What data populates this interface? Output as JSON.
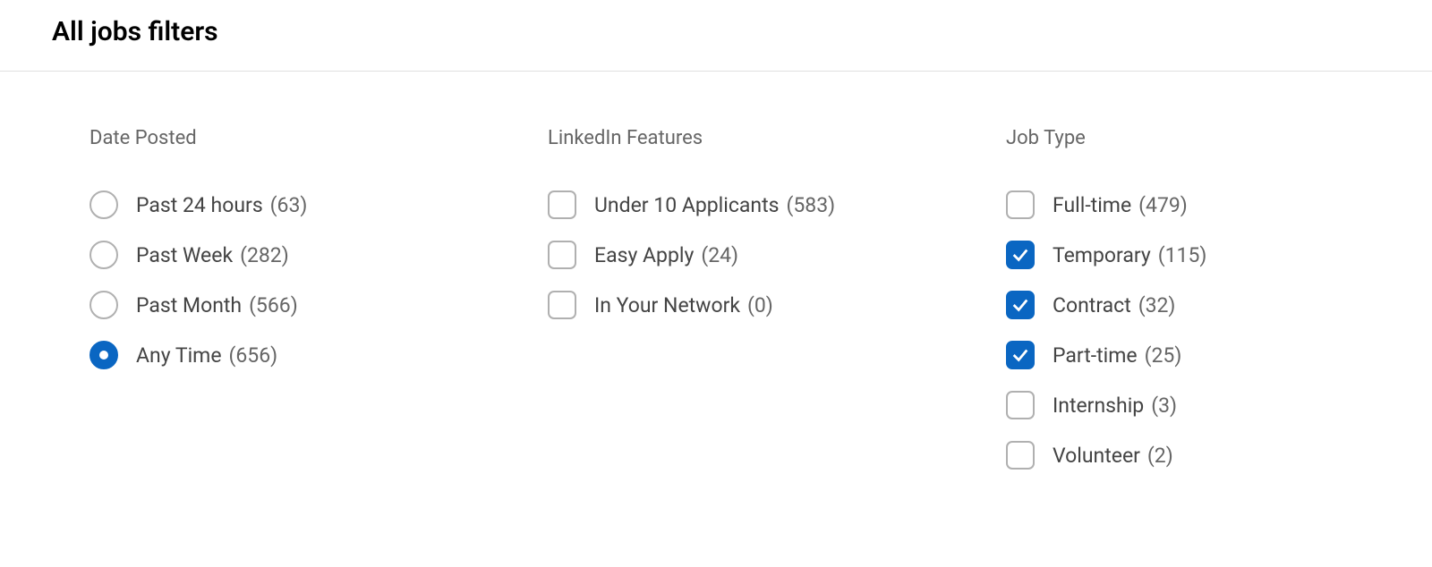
{
  "header": {
    "title": "All jobs filters"
  },
  "groups": {
    "datePosted": {
      "title": "Date Posted",
      "options": [
        {
          "label": "Past 24 hours",
          "count": "(63)",
          "selected": false
        },
        {
          "label": "Past Week",
          "count": "(282)",
          "selected": false
        },
        {
          "label": "Past Month",
          "count": "(566)",
          "selected": false
        },
        {
          "label": "Any Time",
          "count": "(656)",
          "selected": true
        }
      ]
    },
    "linkedinFeatures": {
      "title": "LinkedIn Features",
      "options": [
        {
          "label": "Under 10 Applicants",
          "count": "(583)",
          "checked": false
        },
        {
          "label": "Easy Apply",
          "count": "(24)",
          "checked": false
        },
        {
          "label": "In Your Network",
          "count": "(0)",
          "checked": false
        }
      ]
    },
    "jobType": {
      "title": "Job Type",
      "options": [
        {
          "label": "Full-time",
          "count": "(479)",
          "checked": false
        },
        {
          "label": "Temporary",
          "count": "(115)",
          "checked": true
        },
        {
          "label": "Contract",
          "count": "(32)",
          "checked": true
        },
        {
          "label": "Part-time",
          "count": "(25)",
          "checked": true
        },
        {
          "label": "Internship",
          "count": "(3)",
          "checked": false
        },
        {
          "label": "Volunteer",
          "count": "(2)",
          "checked": false
        }
      ]
    }
  }
}
